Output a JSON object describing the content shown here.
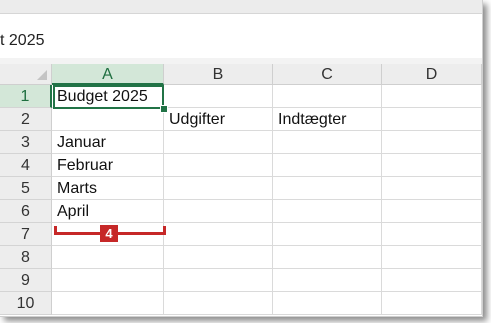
{
  "formula_bar": {
    "text": "t 2025"
  },
  "columns": [
    "A",
    "B",
    "C",
    "D"
  ],
  "rows": [
    "1",
    "2",
    "3",
    "4",
    "5",
    "6",
    "7",
    "8",
    "9",
    "10"
  ],
  "active_cell": "A1",
  "cells": {
    "A1": "Budget 2025",
    "B2": "Udgifter",
    "C2": "Indtægter",
    "A3": "Januar",
    "A4": "Februar",
    "A5": "Marts",
    "A6": "April"
  },
  "annotation": {
    "label": "4"
  },
  "colors": {
    "selection": "#217346",
    "marker": "#c62828"
  }
}
